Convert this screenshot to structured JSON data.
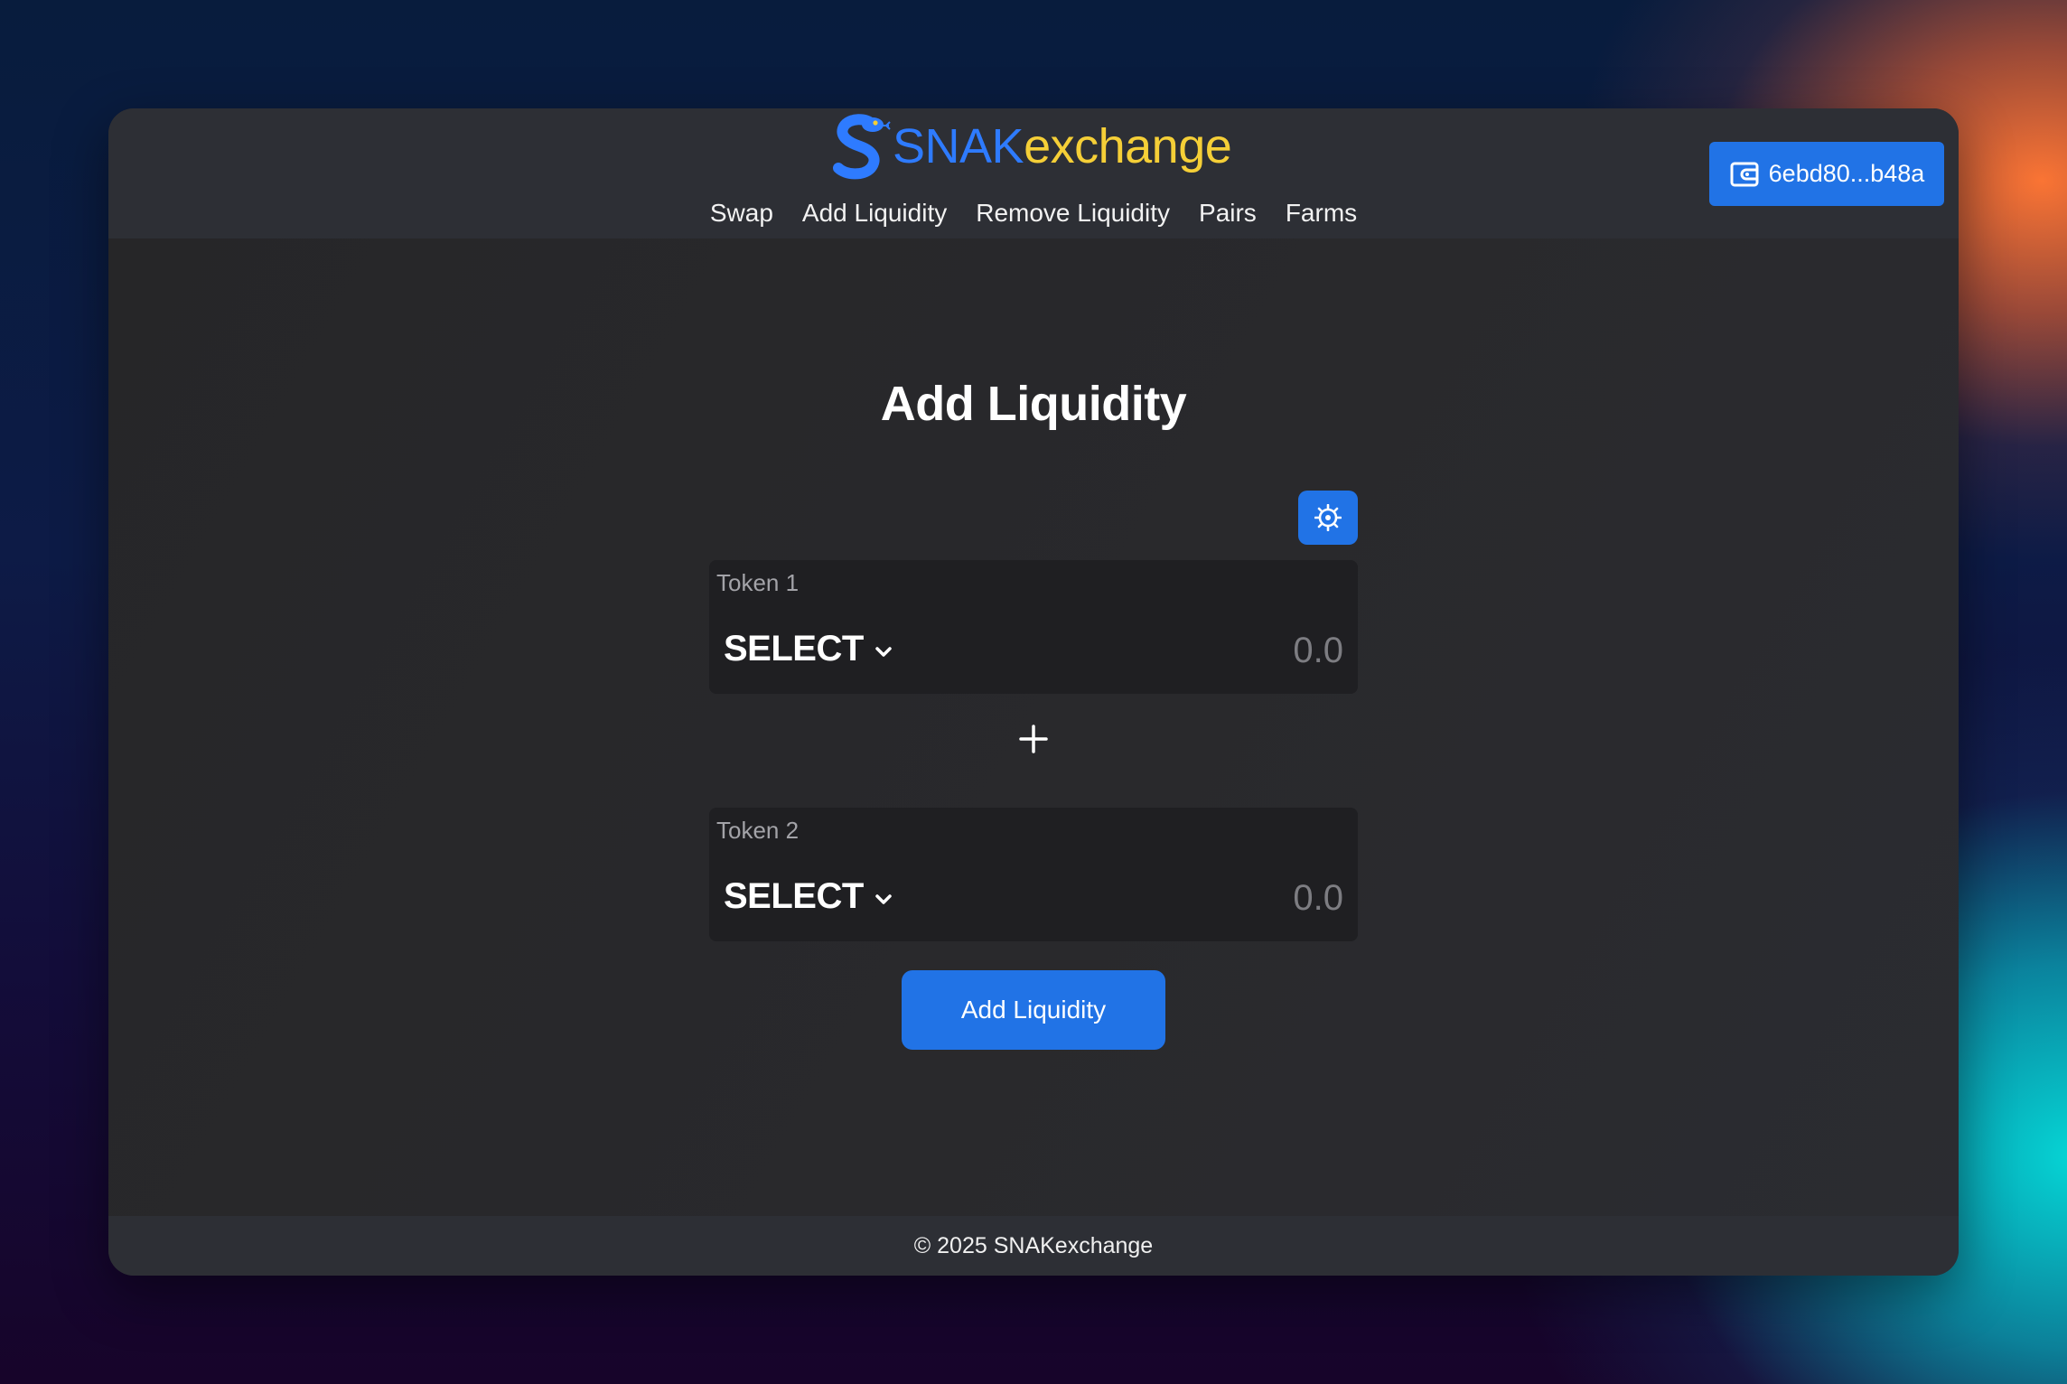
{
  "brand": {
    "name_part1": "SNAK",
    "name_part2": "exchange",
    "logo_icon": "snake-icon",
    "primary_color": "#2e7bff",
    "secondary_color": "#f5cf37"
  },
  "nav": {
    "items": [
      {
        "label": "Swap"
      },
      {
        "label": "Add Liquidity"
      },
      {
        "label": "Remove Liquidity"
      },
      {
        "label": "Pairs"
      },
      {
        "label": "Farms"
      }
    ]
  },
  "wallet": {
    "icon": "wallet-icon",
    "address": "6ebd80...b48a"
  },
  "main": {
    "title": "Add Liquidity",
    "settings_icon": "settings-icon",
    "token1": {
      "label": "Token 1",
      "select_label": "SELECT",
      "amount_placeholder": "0.0"
    },
    "plus_icon": "plus-icon",
    "token2": {
      "label": "Token 2",
      "select_label": "SELECT",
      "amount_placeholder": "0.0"
    },
    "submit_label": "Add Liquidity"
  },
  "footer": {
    "text": "© 2025 SNAKexchange"
  },
  "colors": {
    "accent": "#2173e6",
    "panel": "#1f1f22",
    "header": "#2d2f35"
  }
}
